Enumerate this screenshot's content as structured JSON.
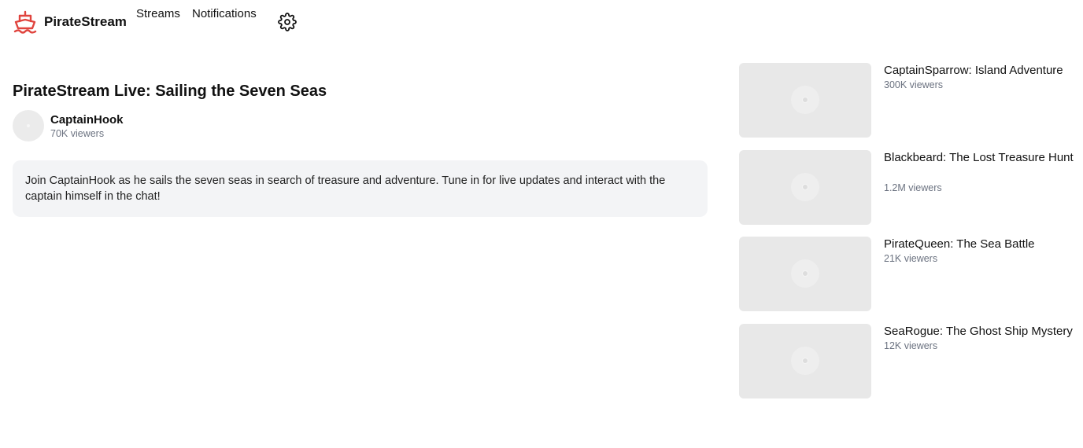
{
  "header": {
    "brand": "PirateStream",
    "nav": [
      {
        "label": "Streams"
      },
      {
        "label": "Notifications"
      }
    ],
    "settings_icon": "gear-icon",
    "logo_icon": "ship-icon",
    "brand_color": "#e0443e"
  },
  "main": {
    "title": "PirateStream Live: Sailing the Seven Seas",
    "streamer": {
      "name": "CaptainHook",
      "viewers": "70K viewers"
    },
    "description": "Join CaptainHook as he sails the seven seas in search of treasure and adventure. Tune in for live updates and interact with the captain himself in the chat!"
  },
  "recommended": [
    {
      "title": "CaptainSparrow: Island Adventure",
      "viewers": "300K viewers"
    },
    {
      "title": "Blackbeard: The Lost Treasure Hunt",
      "viewers": "1.2M viewers"
    },
    {
      "title": "PirateQueen: The Sea Battle",
      "viewers": "21K viewers"
    },
    {
      "title": "SeaRogue: The Ghost Ship Mystery",
      "viewers": "12K viewers"
    }
  ]
}
